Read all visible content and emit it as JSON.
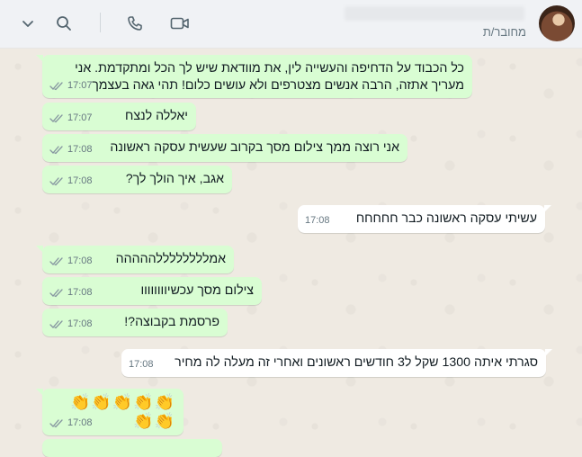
{
  "header": {
    "contact_name": "",
    "status": "מחובר/ת",
    "icons": [
      "chevron-down-icon",
      "search-icon",
      "phone-icon",
      "video-icon"
    ]
  },
  "colors": {
    "outgoing_bubble": "#d9fdd3",
    "incoming_bubble": "#ffffff",
    "header_bg": "#f0f2f5",
    "wallpaper": "#efeae2",
    "read_ticks": "#8696a0"
  },
  "messages": [
    {
      "dir": "out",
      "text": "כל הכבוד על הדחיפה והעשייה לין, את מוודאת שיש לך הכל ומתקדמת. אני מעריך אתזה, הרבה אנשים מצטרפים ולא עושים כלום! תהי גאה בעצמך",
      "time": "17:07"
    },
    {
      "dir": "out",
      "text": "יאללה לנצח",
      "time": "17:07"
    },
    {
      "dir": "out",
      "text": "אני רוצה ממך צילום מסך בקרוב שעשית עסקה ראשונה",
      "time": "17:08"
    },
    {
      "dir": "out",
      "text": "אגב, איך הולך לך?",
      "time": "17:08"
    },
    {
      "dir": "in",
      "text": "עשיתי עסקה ראשונה כבר חחחחח",
      "time": "17:08"
    },
    {
      "dir": "out",
      "text": "אמללללללללההההה",
      "time": "17:08"
    },
    {
      "dir": "out",
      "text": "צילום מסך עכשיוווווווו",
      "time": "17:08"
    },
    {
      "dir": "out",
      "text": "פרסמת בקבוצה?!",
      "time": "17:08"
    },
    {
      "dir": "in",
      "text": "סגרתי איתה 1300 שקל ל3 חודשים ראשונים ואחרי זה מעלה לה מחיר",
      "time": "17:08"
    },
    {
      "dir": "out",
      "text": "👏👏👏👏👏👏👏",
      "time": "17:08"
    }
  ]
}
